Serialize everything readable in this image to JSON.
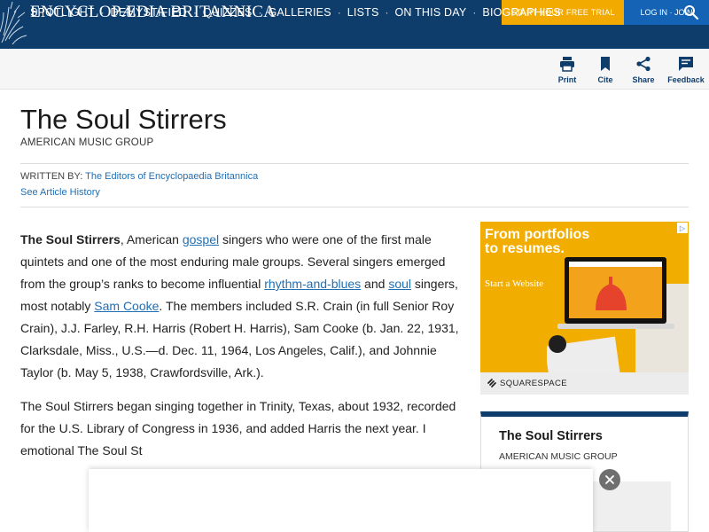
{
  "header": {
    "brand": "ENCYCLOPÆDIA BRITANNICA",
    "trial_button": "START YOUR FREE TRIAL",
    "login_button": "LOG IN · JOIN"
  },
  "nav": {
    "items": [
      "SPOTLIGHT",
      "DEMYSTIFIED",
      "QUIZZES",
      "GALLERIES",
      "LISTS",
      "ON THIS DAY",
      "BIOGRAPHIES"
    ],
    "separator": "·",
    "search_icon": "search-icon"
  },
  "actions": {
    "print": "Print",
    "cite": "Cite",
    "share": "Share",
    "feedback": "Feedback"
  },
  "article": {
    "title": "The Soul Stirrers",
    "subtitle": "AMERICAN MUSIC GROUP",
    "written_by_label": "WRITTEN BY:",
    "written_by_author": "The Editors of Encyclopaedia Britannica",
    "history_link": "See Article History",
    "p1": {
      "bold": "The Soul Stirrers",
      "t1": ", American ",
      "l1": "gospel",
      "t2": " singers who were one of the first male quintets and one of the most enduring male groups. Several singers emerged from the group’s ranks to become influential ",
      "l2": "rhythm-and-blues",
      "t3": " and ",
      "l3": "soul",
      "t4": " singers, most notably ",
      "l4": "Sam Cooke",
      "t5": ". The members included S.R. Crain (in full Senior Roy Crain), J.J. Farley, R.H. Harris (Robert H. Harris), Sam Cooke (b. Jan. 22, 1931, Clarksdale, Miss., U.S.—d. Dec. 11, 1964, Los Angeles, Calif.), and Johnnie Taylor (b. May 5, 1938, Crawfordsville, Ark.)."
    },
    "p2": "The Soul Stirrers began singing together in Trinity, Texas, about 1932, recorded for the U.S. Library of Congress in 1936, and added Harris the next year. I emotional The Soul St"
  },
  "ad": {
    "headline": "From portfolios to resumes.",
    "cta": "Start a Website",
    "brand": "SQUARESPACE",
    "info_glyph": "▷",
    "colors": {
      "background": "#f2ae00"
    }
  },
  "sidebar_card": {
    "title": "The Soul Stirrers",
    "subtitle": "AMERICAN MUSIC GROUP"
  },
  "overlay": {
    "close_glyph": "✕"
  },
  "colors": {
    "navy": "#0f3d6b",
    "trial": "#f2a900",
    "login": "#1463b4",
    "link": "#1f6fb5"
  }
}
